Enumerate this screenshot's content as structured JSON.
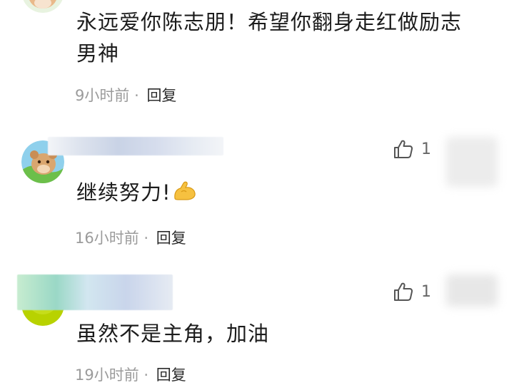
{
  "comments": [
    {
      "text_line1": "永远爱你陈志朋！希望你翻身走红做励志",
      "text_line2": "男神",
      "time": "9小时前",
      "separator": "·",
      "reply": "回复"
    },
    {
      "text": "继续努力!",
      "emoji": "flexed-biceps-emoji",
      "time": "16小时前",
      "separator": "·",
      "reply": "回复",
      "likes": "1"
    },
    {
      "text": "虽然不是主角，加油",
      "time": "19小时前",
      "separator": "·",
      "reply": "回复",
      "likes": "1"
    }
  ],
  "colors": {
    "text": "#1c1c1c",
    "meta": "#9b9b9b",
    "reply": "#2b2b2b",
    "like": "#666666"
  }
}
